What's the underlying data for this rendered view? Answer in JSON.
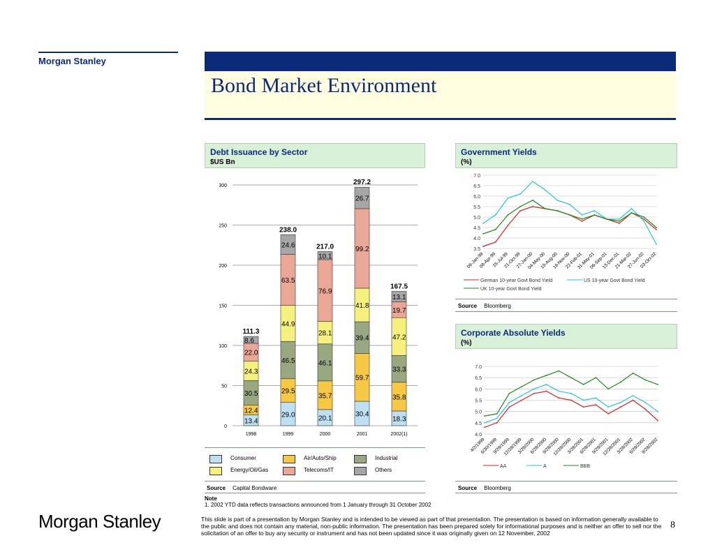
{
  "header": {
    "brand": "Morgan Stanley",
    "title": "Bond Market Environment"
  },
  "debt_panel": {
    "title": "Debt Issuance by Sector",
    "unit": "$US Bn",
    "source_label": "Source",
    "source_value": "Capital Bondware"
  },
  "gov_panel": {
    "title": "Government Yields",
    "unit": "(%)",
    "source_label": "Source",
    "source_value": "Bloomberg"
  },
  "corp_panel": {
    "title": "Corporate Absolute Yields",
    "unit": "(%)",
    "source_label": "Source",
    "source_value": "Bloomberg"
  },
  "note": {
    "label": "Note",
    "text": "1.  2002 YTD data reflects transactions announced from 1 January through 31 October 2002"
  },
  "footer": {
    "disclaimer": "This slide is part of a presentation by Morgan Stanley and is intended to be viewed as part of that presentation.  The presentation is based on information generally available to the public and does not contain any material, non-public information.  The presentation has been prepared solely for informational purposes and is neither an offer to sell nor the solicitation of an offer to buy any security or instrument and has not been updated since it was originally given on 12 November, 2002",
    "page": "8",
    "logo": "Morgan Stanley"
  },
  "colors": {
    "navy": "#0b2a7a",
    "Consumer": "#bde0f5",
    "Energy/Oil/Gas": "#f6f07c",
    "Air/Auto/Ship": "#f7c844",
    "Telecoms/IT": "#eba796",
    "Industrial": "#98a880",
    "Others": "#a6a6a6",
    "German": "#e02020",
    "US": "#20c8d0",
    "UK": "#1a8a1a",
    "AA": "#e02020",
    "A": "#20c8d0",
    "BBB": "#1a8a1a"
  },
  "chart_data": [
    {
      "type": "bar",
      "stacked": true,
      "title": "Debt Issuance by Sector",
      "ylabel": "$US Bn",
      "categories": [
        "1998",
        "1999",
        "2000",
        "2001",
        "2002(1)"
      ],
      "ylim": [
        0,
        300
      ],
      "yticks": [
        0,
        50,
        100,
        150,
        200,
        250,
        300
      ],
      "series": [
        {
          "name": "Consumer",
          "values": [
            13.4,
            29.0,
            20.1,
            30.4,
            18.3
          ]
        },
        {
          "name": "Air/Auto/Ship",
          "values": [
            12.4,
            29.5,
            35.7,
            59.7,
            35.8
          ]
        },
        {
          "name": "Industrial",
          "values": [
            30.5,
            46.5,
            46.1,
            39.4,
            33.3
          ]
        },
        {
          "name": "Energy/Oil/Gas",
          "values": [
            24.3,
            44.9,
            28.1,
            41.8,
            47.2
          ]
        },
        {
          "name": "Telecoms/IT",
          "values": [
            22.0,
            63.5,
            76.9,
            99.2,
            19.7
          ]
        },
        {
          "name": "Others",
          "values": [
            8.6,
            24.6,
            10.1,
            26.7,
            13.1
          ]
        }
      ],
      "totals": [
        "111.3",
        "238.0",
        "217.0",
        "297.2",
        "167.5"
      ],
      "legend_order": [
        "Consumer",
        "Air/Auto/Ship",
        "Industrial",
        "Energy/Oil/Gas",
        "Telecoms/IT",
        "Others"
      ]
    },
    {
      "type": "line",
      "title": "Government Yields",
      "ylabel": "(%)",
      "ylim": [
        3.5,
        7.0
      ],
      "yticks": [
        "7.0",
        "6.5",
        "6.0",
        "5.5",
        "5.0",
        "4.5",
        "4.0",
        "3.5"
      ],
      "x_labels": [
        "06-Jan-99",
        "08-Apr-99",
        "15-Jul-99",
        "21-Oct-99",
        "27-Jan-00",
        "04-May-00",
        "10-Aug-00",
        "16-Nov-00",
        "22-Feb-01",
        "31-May-01",
        "06-Sep-01",
        "13-Dec-01",
        "21-Mar-02",
        "27-Jun-02",
        "03-Oct-02"
      ],
      "series": [
        {
          "name": "German 10-year Govt Bond Yield",
          "values": [
            3.6,
            3.8,
            4.6,
            5.3,
            5.5,
            5.4,
            5.3,
            5.1,
            4.8,
            5.1,
            4.9,
            4.7,
            5.2,
            4.9,
            4.4
          ]
        },
        {
          "name": "US 10-year Govt Bond Yield",
          "values": [
            4.7,
            5.1,
            5.9,
            6.1,
            6.7,
            6.3,
            5.8,
            5.6,
            5.1,
            5.3,
            4.9,
            4.9,
            5.4,
            4.8,
            3.7
          ]
        },
        {
          "name": "UK 10-year Govt Bond Yield",
          "values": [
            4.2,
            4.4,
            5.1,
            5.5,
            5.8,
            5.4,
            5.3,
            5.1,
            4.9,
            5.1,
            4.9,
            4.8,
            5.2,
            5.0,
            4.5
          ]
        }
      ]
    },
    {
      "type": "line",
      "title": "Corporate Absolute Yields",
      "ylabel": "(%)",
      "ylim": [
        4.0,
        7.0
      ],
      "yticks": [
        "7.0",
        "6.5",
        "6.0",
        "5.5",
        "5.0",
        "4.5",
        "4.0"
      ],
      "x_labels": [
        "4/2/1999",
        "6/30/1999",
        "9/28/1999",
        "12/28/1999",
        "3/28/2000",
        "6/28/2000",
        "9/28/2000",
        "12/28/2000",
        "3/28/2001",
        "6/28/2001",
        "9/28/2001",
        "12/28/2001",
        "3/28/2002",
        "6/28/2002",
        "9/28/2002"
      ],
      "series": [
        {
          "name": "AA",
          "values": [
            4.3,
            4.5,
            5.2,
            5.5,
            5.8,
            5.9,
            5.6,
            5.5,
            5.2,
            5.3,
            4.9,
            5.2,
            5.5,
            5.1,
            4.6
          ]
        },
        {
          "name": "A",
          "values": [
            4.5,
            4.7,
            5.4,
            5.7,
            6.0,
            6.2,
            5.9,
            5.8,
            5.5,
            5.6,
            5.2,
            5.4,
            5.7,
            5.4,
            5.0
          ]
        },
        {
          "name": "BBB",
          "values": [
            4.8,
            4.9,
            5.8,
            6.1,
            6.4,
            6.6,
            6.8,
            6.5,
            6.2,
            6.5,
            6.0,
            6.3,
            6.7,
            6.4,
            6.2
          ]
        }
      ]
    }
  ]
}
